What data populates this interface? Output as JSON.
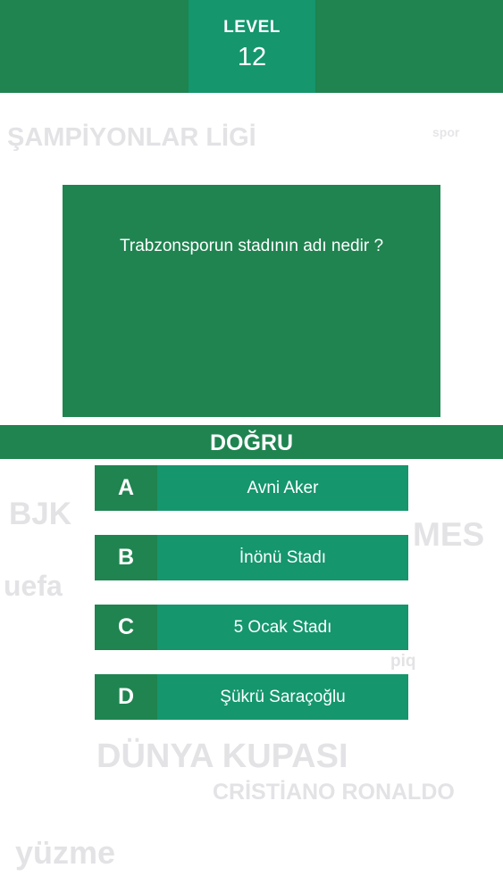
{
  "level": {
    "label": "LEVEL",
    "number": "12"
  },
  "background_words": [
    "ŞAMPİYONLAR LİGİ",
    "spor",
    "BJK",
    "MES",
    "uefa",
    "piq",
    "DÜNYA KUPASI",
    "CRİSTİANO RONALDO",
    "yüzme"
  ],
  "question": {
    "text": "Trabzonsporun stadının adı nedir ?"
  },
  "result": {
    "label": "DOĞRU"
  },
  "options": [
    {
      "letter": "A",
      "text": "Avni Aker"
    },
    {
      "letter": "B",
      "text": "İnönü Stadı"
    },
    {
      "letter": "C",
      "text": "5 Ocak Stadı"
    },
    {
      "letter": "D",
      "text": "Şükrü Saraçoğlu"
    }
  ],
  "colors": {
    "dark_green": "#1f8450",
    "teal_green": "#15966d",
    "background": "#ffffff",
    "watermark_text": "#e3e3e6"
  }
}
